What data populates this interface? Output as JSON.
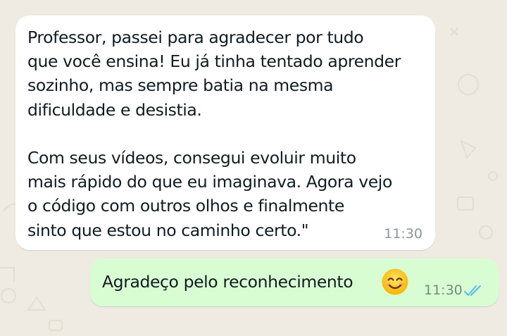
{
  "colors": {
    "wallpaper": "#efeae2",
    "incoming_bubble": "#ffffff",
    "outgoing_bubble": "#d9fdd3",
    "read_ticks": "#53bdeb"
  },
  "messages": {
    "incoming": {
      "text": "Professor, passei para agradecer por tudo\nque você ensina! Eu já tinha tentado aprender\nsozinho, mas sempre batia na mesma\ndificuldade e desistia.\n\nCom seus vídeos, consegui evoluir muito\nmais rápido do que eu imaginava. Agora vejo\no código com outros olhos e finalmente\nsinto que estou no caminho certo.\"",
      "time": "11:30"
    },
    "outgoing": {
      "text": "Agradeço pelo reconhecimento",
      "emoji": "smiling-face-with-smiling-eyes",
      "time": "11:30",
      "status": "read"
    }
  }
}
